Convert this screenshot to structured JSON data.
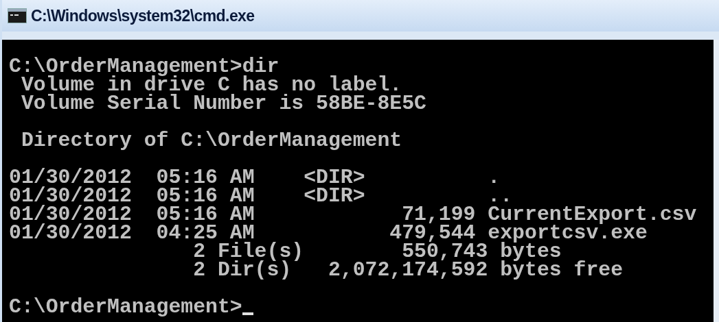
{
  "window": {
    "title": "C:\\Windows\\system32\\cmd.exe"
  },
  "console": {
    "blocks": [
      [
        "C:\\OrderManagement>dir",
        " Volume in drive C has no label.",
        " Volume Serial Number is 58BE-8E5C"
      ],
      [
        " Directory of C:\\OrderManagement"
      ],
      [
        "01/30/2012  05:16 AM    <DIR>          .",
        "01/30/2012  05:16 AM    <DIR>          ..",
        "01/30/2012  05:16 AM            71,199 CurrentExport.csv",
        "01/30/2012  04:25 AM           479,544 exportcsv.exe",
        "               2 File(s)        550,743 bytes",
        "               2 Dir(s)   2,072,174,592 bytes free"
      ]
    ],
    "prompt": "C:\\OrderManagement>"
  }
}
